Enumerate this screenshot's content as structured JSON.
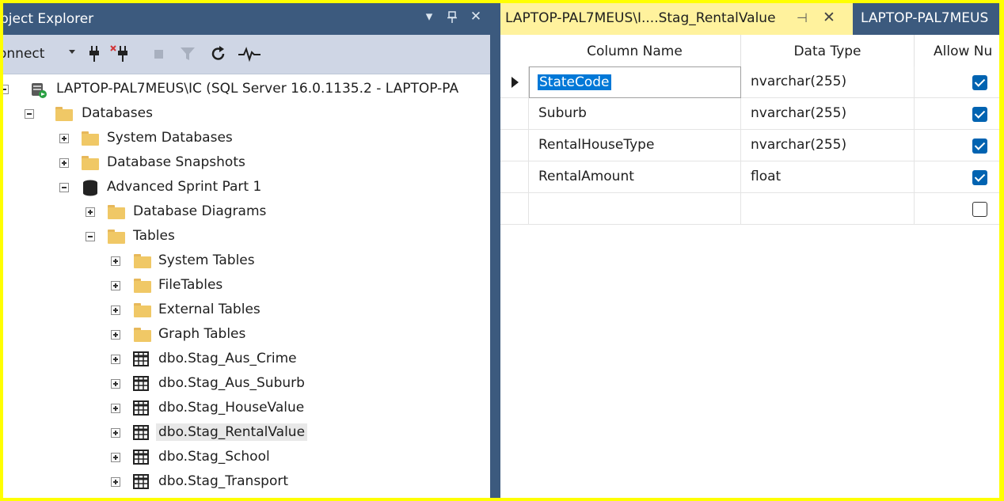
{
  "colors": {
    "highlight_border": "#ffff00",
    "panel_title": "#3c5a7e",
    "toolbar": "#cfd6e5",
    "tab_active": "#fff29d",
    "checkbox": "#0063b1",
    "selection": "#0078d7"
  },
  "object_explorer": {
    "title": "bject Explorer",
    "title_buttons": [
      "▾",
      "ᵖ",
      "✕"
    ],
    "toolbar": {
      "connect_label": "onnect",
      "icons": [
        "plug-icon",
        "disconnect-icon",
        "stop-icon",
        "filter-icon",
        "refresh-icon",
        "activity-monitor-icon"
      ]
    },
    "tree": [
      {
        "label": "LAPTOP-PAL7MEUS\\IC (SQL Server 16.0.1135.2 - LAPTOP-PA",
        "depth": 0,
        "icon": "server-icon",
        "expanded": true
      },
      {
        "label": "Databases",
        "depth": 1,
        "icon": "folder-icon",
        "expanded": true
      },
      {
        "label": "System Databases",
        "depth": 2,
        "icon": "folder-icon",
        "expanded": false
      },
      {
        "label": "Database Snapshots",
        "depth": 2,
        "icon": "folder-icon",
        "expanded": false
      },
      {
        "label": "Advanced Sprint Part 1",
        "depth": 2,
        "icon": "database-icon",
        "expanded": true
      },
      {
        "label": "Database Diagrams",
        "depth": 3,
        "icon": "folder-icon",
        "expanded": false
      },
      {
        "label": "Tables",
        "depth": 3,
        "icon": "folder-icon",
        "expanded": true
      },
      {
        "label": "System Tables",
        "depth": 4,
        "icon": "folder-icon",
        "expanded": false
      },
      {
        "label": "FileTables",
        "depth": 4,
        "icon": "folder-icon",
        "expanded": false
      },
      {
        "label": "External Tables",
        "depth": 4,
        "icon": "folder-icon",
        "expanded": false
      },
      {
        "label": "Graph Tables",
        "depth": 4,
        "icon": "folder-icon",
        "expanded": false
      },
      {
        "label": "dbo.Stag_Aus_Crime",
        "depth": 4,
        "icon": "table-icon",
        "expanded": false
      },
      {
        "label": "dbo.Stag_Aus_Suburb",
        "depth": 4,
        "icon": "table-icon",
        "expanded": false
      },
      {
        "label": "dbo.Stag_HouseValue",
        "depth": 4,
        "icon": "table-icon",
        "expanded": false
      },
      {
        "label": "dbo.Stag_RentalValue",
        "depth": 4,
        "icon": "table-icon",
        "expanded": false,
        "selected": true
      },
      {
        "label": "dbo.Stag_School",
        "depth": 4,
        "icon": "table-icon",
        "expanded": false
      },
      {
        "label": "dbo.Stag_Transport",
        "depth": 4,
        "icon": "table-icon",
        "expanded": false
      }
    ]
  },
  "tabs": {
    "active_label": "LAPTOP-PAL7MEUS\\I....Stag_RentalValue",
    "pin_glyph": "⊣",
    "close_glyph": "✕",
    "inactive_label": "LAPTOP-PAL7MEUS"
  },
  "designer": {
    "headers": {
      "column_name": "Column Name",
      "data_type": "Data Type",
      "allow_nulls": "Allow Nu"
    },
    "rows": [
      {
        "name": "StateCode",
        "type": "nvarchar(255)",
        "allow_nulls": true,
        "current": true
      },
      {
        "name": "Suburb",
        "type": "nvarchar(255)",
        "allow_nulls": true
      },
      {
        "name": "RentalHouseType",
        "type": "nvarchar(255)",
        "allow_nulls": true
      },
      {
        "name": "RentalAmount",
        "type": "float",
        "allow_nulls": true
      },
      {
        "name": "",
        "type": "",
        "allow_nulls": false
      }
    ]
  }
}
